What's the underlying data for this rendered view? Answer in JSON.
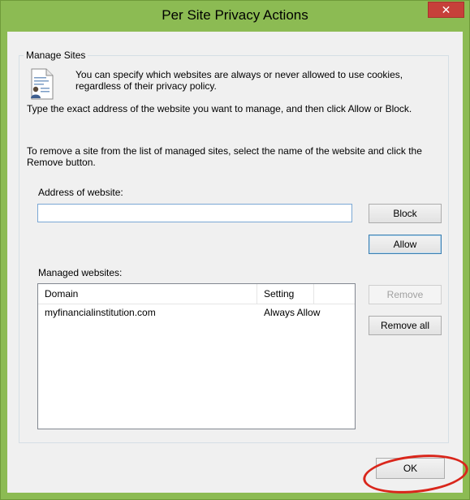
{
  "window": {
    "title": "Per Site Privacy Actions",
    "close_glyph": "✕",
    "frame_color": "#8cbb53"
  },
  "manage_sites": {
    "group_title": "Manage Sites",
    "intro_text": "You can specify which websites are always or never allowed to use cookies, regardless of their privacy policy.",
    "instructions_1": "Type the exact address of the website you want to manage, and then click Allow or Block.",
    "instructions_2": "To remove a site from the list of managed sites, select the name of the website and click the Remove button.",
    "address_label": "Address of website:",
    "address_value": "",
    "managed_label": "Managed websites:",
    "icon": "privacy-document-icon"
  },
  "list": {
    "columns": [
      "Domain",
      "Setting"
    ],
    "rows": [
      {
        "domain": "myfinancialinstitution.com",
        "setting": "Always Allow"
      }
    ]
  },
  "buttons": {
    "block": "Block",
    "allow": "Allow",
    "remove": "Remove",
    "remove_all": "Remove all",
    "ok": "OK"
  },
  "annotation": {
    "ring_color": "#d9261b"
  }
}
